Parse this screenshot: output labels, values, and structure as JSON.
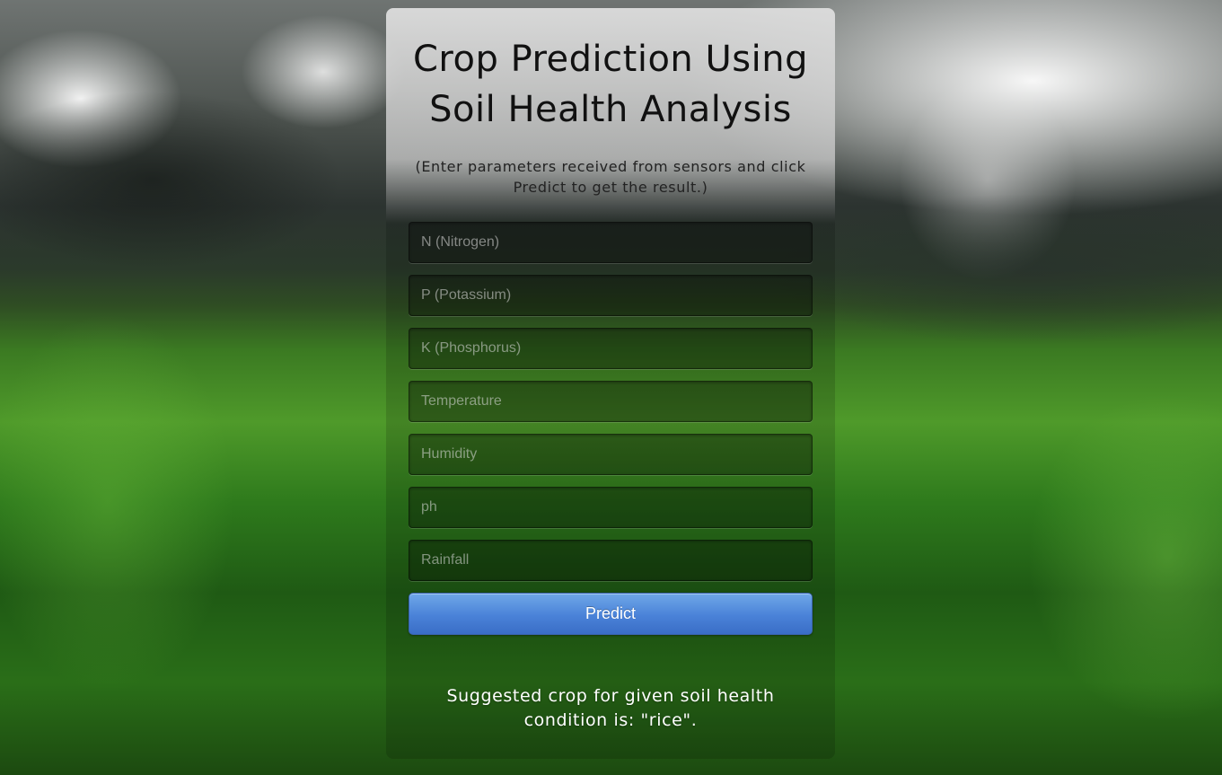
{
  "page": {
    "title": "Crop Prediction Using Soil Health Analysis",
    "subtitle": "(Enter parameters received from sensors and click Predict to get the result.)"
  },
  "form": {
    "fields": [
      {
        "placeholder": "N (Nitrogen)",
        "value": ""
      },
      {
        "placeholder": "P (Potassium)",
        "value": ""
      },
      {
        "placeholder": "K (Phosphorus)",
        "value": ""
      },
      {
        "placeholder": "Temperature",
        "value": ""
      },
      {
        "placeholder": "Humidity",
        "value": ""
      },
      {
        "placeholder": "ph",
        "value": ""
      },
      {
        "placeholder": "Rainfall",
        "value": ""
      }
    ],
    "submit_label": "Predict"
  },
  "result": {
    "text": "Suggested crop for given soil health condition is: \"rice\"."
  },
  "colors": {
    "button_accent": "#4a82d8",
    "title_text": "#111111",
    "result_text": "#ffffff"
  }
}
